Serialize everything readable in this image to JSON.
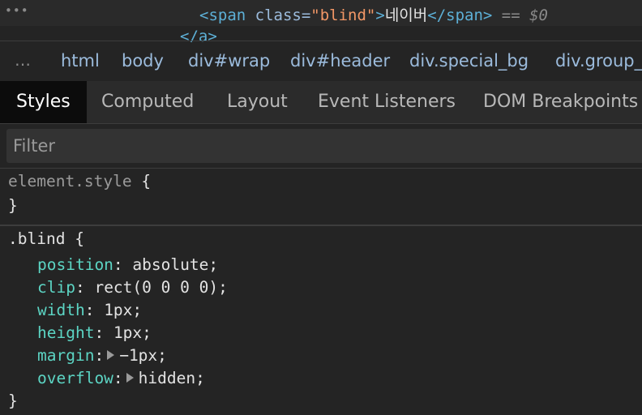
{
  "dom": {
    "dots": "•••",
    "line1": {
      "open_tag": "<span",
      "attr_name": " class=",
      "attr_value": "\"blind\"",
      "open_close": ">",
      "text": "네이버",
      "close_tag": "</span>",
      "eq": " == ",
      "var": "$0"
    },
    "line2": {
      "close_tag": "</a>"
    }
  },
  "breadcrumb": {
    "more": "…",
    "items": [
      "html",
      "body",
      "div#wrap",
      "div#header",
      "div.special_bg",
      "div.group_"
    ]
  },
  "tabs": [
    "Styles",
    "Computed",
    "Layout",
    "Event Listeners",
    "DOM Breakpoints"
  ],
  "filter": {
    "placeholder": "Filter",
    "value": ""
  },
  "rules": {
    "element_style": {
      "selector": "element.style",
      "open": " {",
      "close": "}"
    },
    "blind": {
      "selector": ".blind",
      "open": " {",
      "close": "}",
      "declarations": [
        {
          "prop": "position",
          "value": "absolute;"
        },
        {
          "prop": "clip",
          "value": "rect(0 0 0 0);"
        },
        {
          "prop": "width",
          "value": "1px;"
        },
        {
          "prop": "height",
          "value": "1px;"
        },
        {
          "prop": "margin",
          "value": "−1px;"
        },
        {
          "prop": "overflow",
          "value": "hidden;"
        }
      ]
    }
  }
}
